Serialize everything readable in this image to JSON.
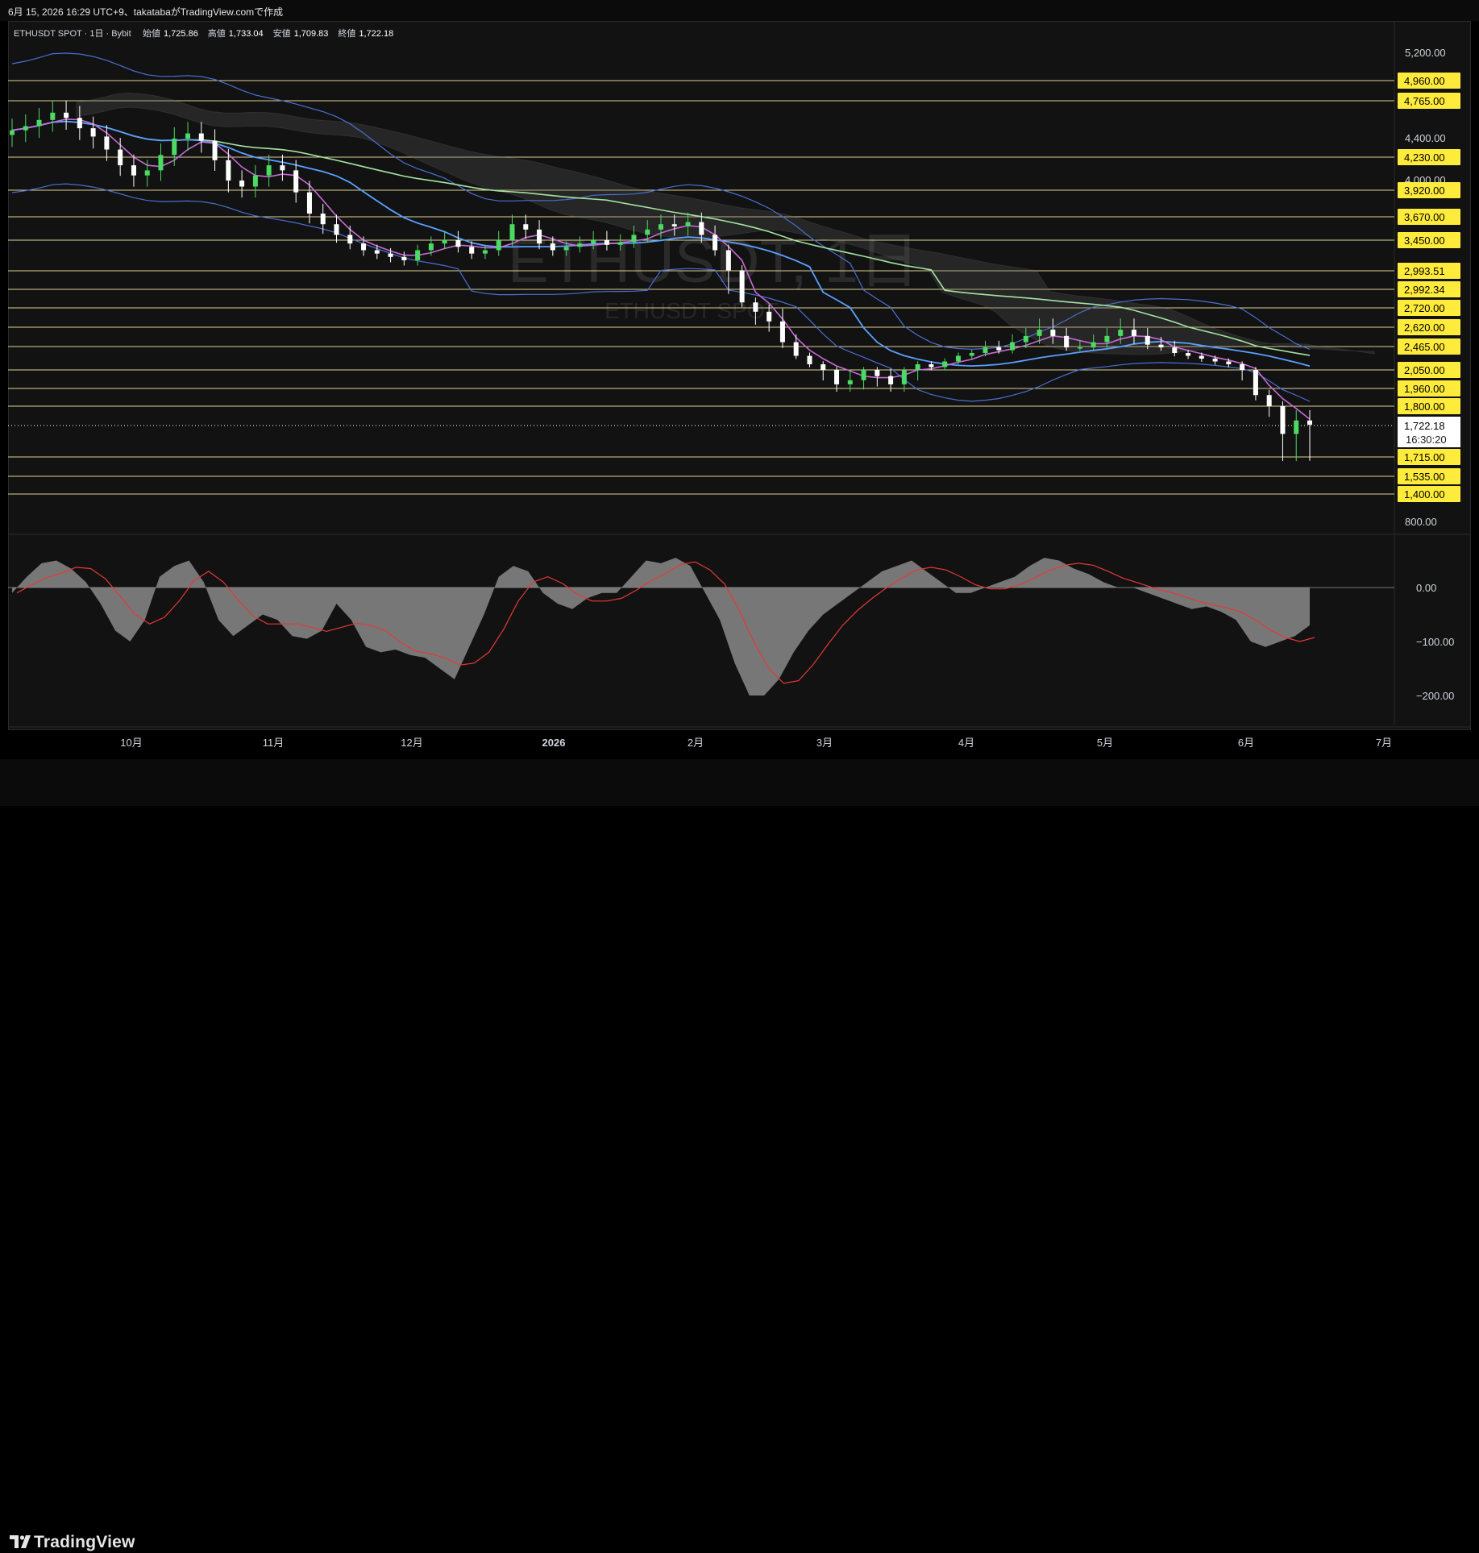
{
  "header": {
    "caption": "6月 15, 2026 16:29 UTC+9、takatabaがTradingView.comで作成"
  },
  "legend": {
    "symbol": "ETHUSDT SPOT · 1日 · Bybit",
    "open_label": "始値",
    "open": "1,725.86",
    "high_label": "高値",
    "high": "1,733.04",
    "low_label": "安値",
    "low": "1,709.83",
    "close_label": "終値",
    "close": "1,722.18"
  },
  "watermark": {
    "title": "ETHUSDT, 1日",
    "subtitle": "ETHUSDT SPOT"
  },
  "brand": {
    "name": "TradingView"
  },
  "colors": {
    "up": "#4cd964",
    "down": "#ffffff",
    "level_line": "#f5e6a3",
    "level_bg": "#ffeb3b",
    "bollinger": "#4a6fd1",
    "ma_blue": "#5aa0ff",
    "ma_purple": "#c86ad6",
    "ma_green": "#a3e4a0",
    "macd_hist": "#8a8a8a",
    "macd_signal": "#e53935",
    "price_badge": "#ffffff"
  },
  "chart_data": {
    "type": "candlestick",
    "title": "ETHUSDT, 1日",
    "price_axis_ticks": [
      "5,200.00",
      "4,400.00",
      "4,000.00",
      "800.00"
    ],
    "horizontal_levels": [
      4960,
      4765,
      4230,
      3920,
      3670,
      3450,
      2993.51,
      2992.34,
      2720,
      2620,
      2465,
      2050,
      1960,
      1800,
      1715,
      1535,
      1400
    ],
    "level_labels": [
      "4,960.00",
      "4,765.00",
      "4,230.00",
      "3,920.00",
      "3,670.00",
      "3,450.00",
      "2,993.51",
      "2,992.34",
      "2,720.00",
      "2,620.00",
      "2,465.00",
      "2,050.00",
      "1,960.00",
      "1,800.00",
      "1,715.00",
      "1,535.00",
      "1,400.00"
    ],
    "current_price": "1,722.18",
    "countdown": "16:30:20",
    "x_axis_labels": [
      "10月",
      "11月",
      "12月",
      "2026",
      "2月",
      "3月",
      "4月",
      "5月",
      "6月",
      "7月"
    ],
    "close_series": [
      4480,
      4520,
      4580,
      4650,
      4600,
      4500,
      4420,
      4300,
      4150,
      4050,
      4100,
      4250,
      4400,
      4450,
      4380,
      4200,
      4000,
      3950,
      4050,
      4150,
      4100,
      3900,
      3700,
      3600,
      3500,
      3400,
      3300,
      3250,
      3200,
      3150,
      3300,
      3400,
      3450,
      3350,
      3250,
      3300,
      3450,
      3600,
      3550,
      3400,
      3300,
      3350,
      3400,
      3450,
      3380,
      3420,
      3500,
      3550,
      3600,
      3580,
      3620,
      3500,
      3300,
      3000,
      2800,
      2700,
      2650,
      2500,
      2300,
      2150,
      2050,
      1980,
      2000,
      2050,
      2020,
      1980,
      2050,
      2150,
      2100,
      2200,
      2300,
      2350,
      2450,
      2400,
      2500,
      2550,
      2600,
      2550,
      2450,
      2450,
      2500,
      2550,
      2600,
      2550,
      2480,
      2450,
      2350,
      2300,
      2250,
      2200,
      2150,
      2050,
      1900,
      1800,
      1720,
      1740,
      1722.18
    ],
    "macd_axis_ticks": [
      "0.00",
      "−100.00",
      "−200.00"
    ],
    "macd_histogram": [
      -10,
      20,
      45,
      50,
      35,
      10,
      -30,
      -80,
      -100,
      -60,
      20,
      40,
      50,
      10,
      -60,
      -90,
      -70,
      -50,
      -60,
      -90,
      -95,
      -80,
      -30,
      -60,
      -110,
      -120,
      -115,
      -125,
      -130,
      -150,
      -170,
      -110,
      -50,
      20,
      40,
      30,
      -10,
      -30,
      -40,
      -20,
      -10,
      -10,
      20,
      50,
      45,
      55,
      40,
      -10,
      -60,
      -140,
      -200,
      -200,
      -170,
      -120,
      -80,
      -50,
      -30,
      -10,
      10,
      30,
      40,
      50,
      30,
      10,
      -10,
      -10,
      0,
      10,
      20,
      40,
      55,
      50,
      35,
      25,
      10,
      0,
      0,
      -10,
      -20,
      -30,
      -40,
      -35,
      -45,
      -60,
      -100,
      -110,
      -100,
      -90,
      -70
    ]
  }
}
